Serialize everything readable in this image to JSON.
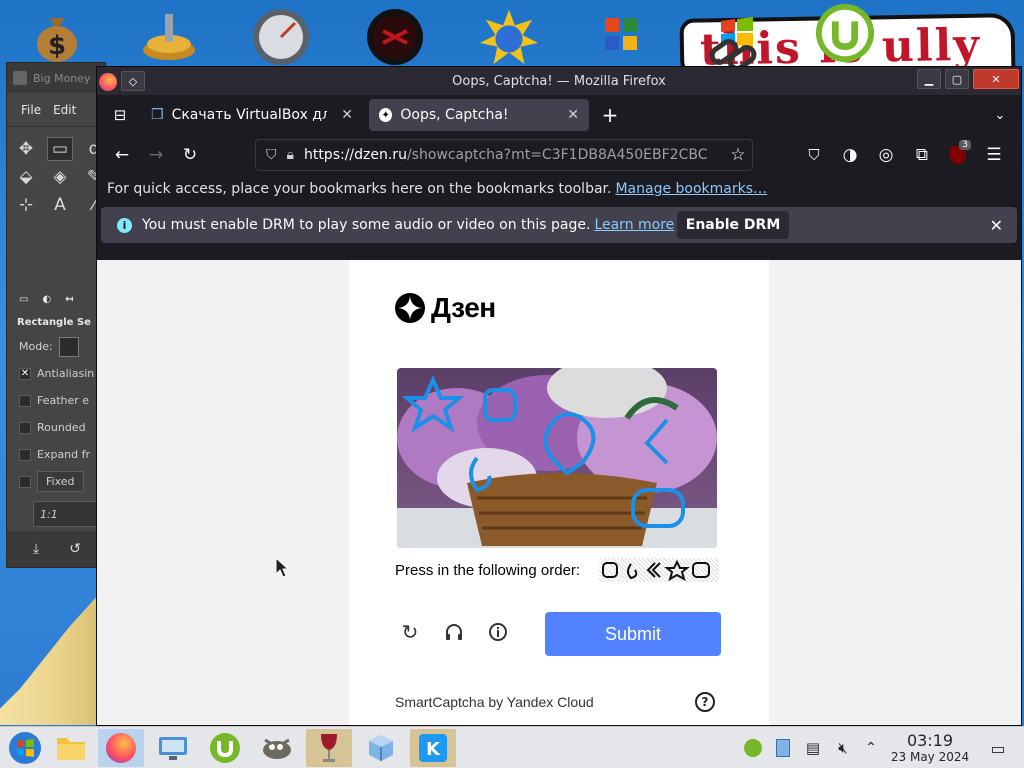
{
  "desktop": {
    "icons": [
      "big-money-icon",
      "gear-icon",
      "gauge-icon",
      "radar-icon",
      "sun-globe-icon",
      "office-icon",
      "chain-icon",
      "utorrent-icon"
    ],
    "banner_text": "this is ully"
  },
  "gimp": {
    "title": "Big Money",
    "menu": [
      "File",
      "Edit"
    ],
    "tool_options_title": "Rectangle Se",
    "mode_label": "Mode:",
    "options": [
      {
        "label": "Antialiasin",
        "checked": true
      },
      {
        "label": "Feather e",
        "checked": false
      },
      {
        "label": "Rounded",
        "checked": false
      },
      {
        "label": "Expand fr",
        "checked": false
      }
    ],
    "fixed_label": "Fixed",
    "ratio_value": "1:1"
  },
  "firefox": {
    "window_title": "Oops, Captcha! — Mozilla Firefox",
    "tabs": [
      {
        "label": "Скачать VirtualBox для",
        "active": false,
        "icon": "virtualbox-cube-icon"
      },
      {
        "label": "Oops, Captcha!",
        "active": true,
        "icon": "dzen-icon"
      }
    ],
    "url_host": "https://dzen.ru",
    "url_rest": "/showcaptcha?mt=C3F1DB8A450EBF2CBC",
    "extension_badge": "3",
    "bookmarks_text": "For quick access, place your bookmarks here on the bookmarks toolbar.",
    "bookmarks_link": "Manage bookmarks…",
    "drm_text": "You must enable DRM to play some audio or video on this page.",
    "drm_link": "Learn more",
    "drm_button": "Enable DRM"
  },
  "captcha": {
    "brand": "Дзен",
    "instruction": "Press in the following order:",
    "submit_label": "Submit",
    "footer": "SmartCaptcha by Yandex Cloud",
    "help_glyph": "?",
    "accent_color": "#5282ff"
  },
  "taskbar": {
    "time": "03:19",
    "date": "23 May 2024",
    "apps": [
      "start-icon",
      "files-icon",
      "firefox-icon",
      "system-settings-icon",
      "utorrent-icon",
      "gimp-icon",
      "wine-icon",
      "virtualbox-icon",
      "kde-icon"
    ]
  }
}
